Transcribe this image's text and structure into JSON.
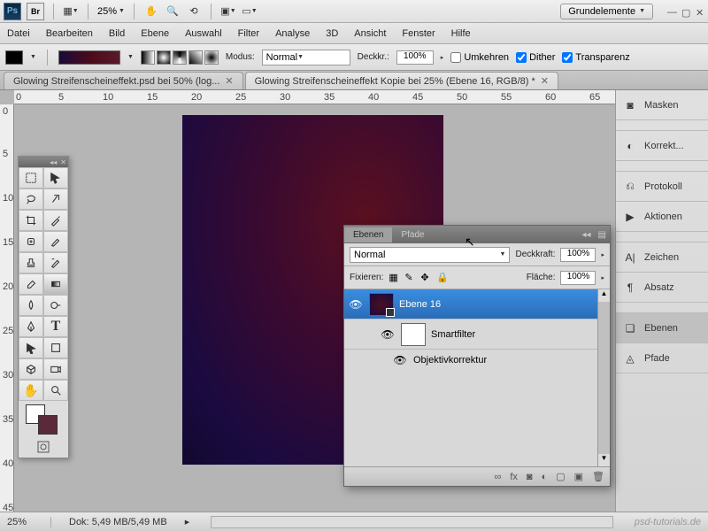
{
  "app": {
    "workspace": "Grundelemente"
  },
  "menu": [
    "Datei",
    "Bearbeiten",
    "Bild",
    "Ebene",
    "Auswahl",
    "Filter",
    "Analyse",
    "3D",
    "Ansicht",
    "Fenster",
    "Hilfe"
  ],
  "titlebar": {
    "zoom": "25%"
  },
  "optbar": {
    "modus_label": "Modus:",
    "modus_value": "Normal",
    "deckkr_label": "Deckkr.:",
    "deckkr_value": "100%",
    "umkehren": "Umkehren",
    "dither": "Dither",
    "transparenz": "Transparenz"
  },
  "tabs": [
    "Glowing Streifenscheineffekt.psd bei 50% (log...",
    "Glowing Streifenscheineffekt Kopie bei 25% (Ebene 16, RGB/8) *"
  ],
  "ruler_h": [
    "0",
    "5",
    "10",
    "15",
    "20",
    "25",
    "30",
    "35",
    "40",
    "45",
    "50",
    "55",
    "60",
    "65"
  ],
  "ruler_v": [
    "0",
    "5",
    "10",
    "15",
    "20",
    "25",
    "30",
    "35",
    "40",
    "45"
  ],
  "right": {
    "masken": "Masken",
    "korrekt": "Korrekt...",
    "protokoll": "Protokoll",
    "aktionen": "Aktionen",
    "zeichen": "Zeichen",
    "absatz": "Absatz",
    "ebenen": "Ebenen",
    "pfade": "Pfade"
  },
  "layers": {
    "tab_ebenen": "Ebenen",
    "tab_pfade": "Pfade",
    "blend": "Normal",
    "deckkraft_label": "Deckkraft:",
    "deckkraft": "100%",
    "fix_label": "Fixieren:",
    "flaeche_label": "Fläche:",
    "flaeche": "100%",
    "rows": [
      {
        "name": "Ebene 16"
      },
      {
        "name": "Smartfilter"
      },
      {
        "name": "Objektivkorrektur"
      }
    ]
  },
  "status": {
    "zoom": "25%",
    "doc_label": "Dok:",
    "doc": "5,49 MB/5,49 MB"
  },
  "watermark": "psd-tutorials.de"
}
